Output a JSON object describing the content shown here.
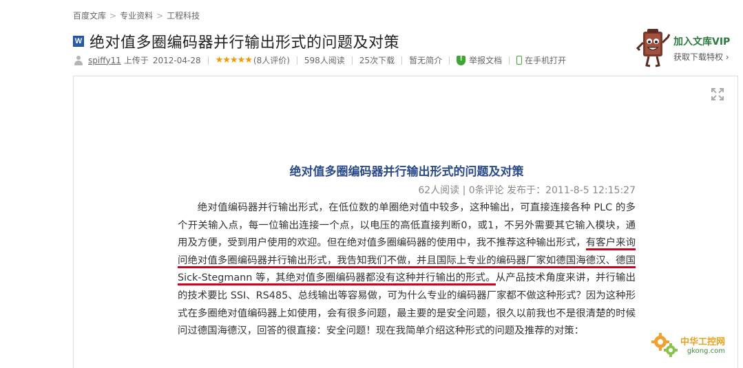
{
  "breadcrumb": {
    "items": [
      "百度文库",
      "专业资料",
      "工程科技"
    ],
    "separator": ">"
  },
  "document": {
    "file_badge": "W",
    "title": "绝对值多圈编码器并行输出形式的问题及对策"
  },
  "meta": {
    "uploader": "spiffy11",
    "uploaded_on_label": "上传于",
    "upload_date": "2012-04-28",
    "rating_stars": 4.5,
    "stars_display": "★★★★★",
    "rating_count": "(8人评价)",
    "reads": "598人阅读",
    "downloads": "25次下载",
    "summary": "暂无简介",
    "report": "举报文档",
    "open_on_phone": "在手机打开"
  },
  "vip": {
    "title": "加入文库VIP",
    "subtitle": "获取下载特权",
    "chevron": "›"
  },
  "article": {
    "title": "绝对值多圈编码器并行输出形式的问题及对策",
    "meta": "62人阅读 | 0条评论  发布于：2011-8-5 12:15:27",
    "body_before": "绝对值编码器并行输出形式，在低位数的单圈绝对值中较多，这种输出，可直接连接各种 PLC 的多个开关输入点，每一位输出连接一个点，以电压的高低直接判断0，或1，不另外需要其它输入模块，通用及方便，受到用户使用的欢迎。但在绝对值多圈编码器的使用中，我不推荐这种输出形式，",
    "body_highlight": "有客户来询问绝对值多圈编码器并行输出形式，我告知我们不做，并且国际上专业的编码器厂家如德国海德汉、德国 Sick-Stegmann 等，其绝对值多圈编码器都没有这种并行输出的形式。",
    "body_after": "从产品技术角度来讲，并行输出的技术要比 SSI、RS485、总线输出等容易做，可为什么专业的编码器厂家都不做这种形式？因为这种形式在多圈绝对值编码器上如使用，会有很多问题，最主要的是安全问题，很久以前我也不是很清楚的时候问过德国海德汉，回答的很直接：安全问题！现在我简单介绍这种形式的问题及推荐的对策："
  },
  "watermark": {
    "cn": "中华工控网",
    "en": "gkong.com"
  },
  "colors": {
    "article_title": "#2a4a8a",
    "highlight_underline": "#d0021b",
    "stars": "#f39800",
    "vip_green": "#2c7a3c"
  },
  "icons": [
    "word-doc-icon",
    "user-icon",
    "shield-icon",
    "phone-icon",
    "fullscreen-icon",
    "vip-mascot-icon",
    "gear-logo-icon"
  ]
}
